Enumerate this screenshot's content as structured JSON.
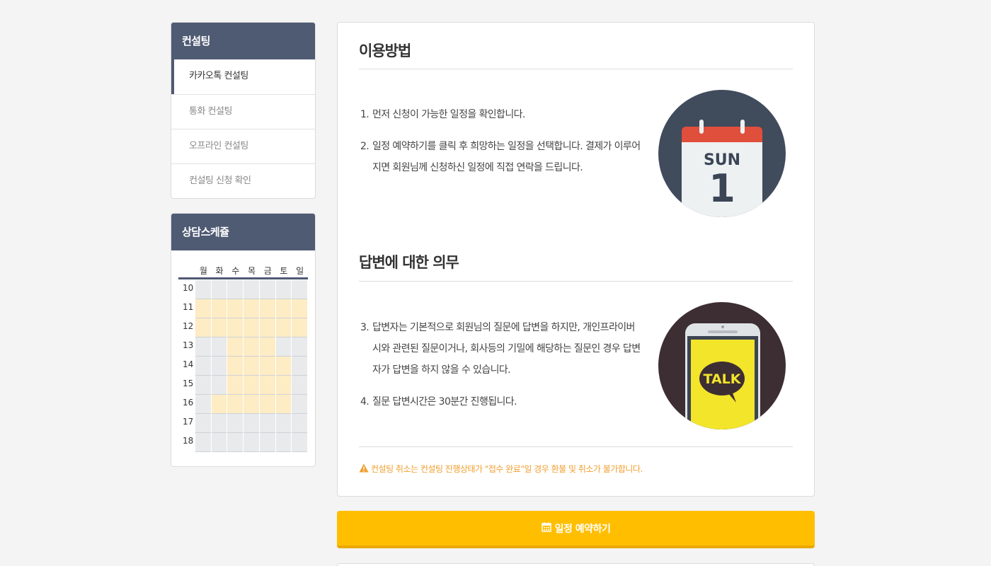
{
  "sidebar": {
    "consulting_title": "컨설팅",
    "menu": [
      {
        "label": "카카오톡 컨설팅",
        "active": true
      },
      {
        "label": "통화 컨설팅",
        "active": false
      },
      {
        "label": "오프라인 컨설팅",
        "active": false
      },
      {
        "label": "컨설팅 신청 확인",
        "active": false
      }
    ],
    "schedule_title": "상담스케쥴",
    "schedule": {
      "days": [
        "월",
        "화",
        "수",
        "목",
        "금",
        "토",
        "일"
      ],
      "hours": [
        "10",
        "11",
        "12",
        "13",
        "14",
        "15",
        "16",
        "17",
        "18"
      ],
      "availability": [
        [
          0,
          0,
          0,
          0,
          0,
          0,
          0
        ],
        [
          1,
          1,
          1,
          1,
          1,
          1,
          1
        ],
        [
          1,
          1,
          1,
          1,
          1,
          1,
          1
        ],
        [
          0,
          0,
          1,
          1,
          1,
          0,
          0
        ],
        [
          0,
          0,
          1,
          1,
          1,
          1,
          0
        ],
        [
          0,
          0,
          1,
          1,
          1,
          1,
          0
        ],
        [
          0,
          1,
          1,
          1,
          1,
          1,
          0
        ],
        [
          0,
          0,
          0,
          0,
          0,
          0,
          0
        ],
        [
          0,
          0,
          0,
          0,
          0,
          0,
          0
        ]
      ]
    }
  },
  "main": {
    "section1": {
      "title": "이용방법",
      "steps": [
        {
          "num": "1.",
          "text": "먼저 신청이 가능한 일정을 확인합니다."
        },
        {
          "num": "2.",
          "text": "일정 예약하기를 클릭 후 희망하는 일정을 선택합니다. 결제가 이루어지면 회원님께 신청하신 일정에 직접 연락을 드립니다."
        }
      ],
      "calendar_day": "SUN",
      "calendar_date": "1"
    },
    "section2": {
      "title": "답변에 대한 의무",
      "steps": [
        {
          "num": "3.",
          "text": "답변자는 기본적으로 회원님의 질문에 답변을 하지만, 개인프라이버시와 관련된 질문이거나, 회사등의 기밀에 해당하는 질문인 경우 답변자가 답변을 하지 않을 수 있습니다."
        },
        {
          "num": "4.",
          "text": "질문 답변시간은 30분간 진행됩니다."
        }
      ],
      "phone_text": "TALK"
    },
    "warning": "컨설팅 취소는 컨설팅 진행상태가 \"접수 완료\"일 경우 환불 및 취소가 불가합니다."
  },
  "reserve_button": {
    "label": "일정 예약하기",
    "icon": "calendar-icon"
  },
  "colors": {
    "sidebar_header": "#4f5a73",
    "button": "#ffbf00",
    "warning": "#f0a030",
    "available": "#fdecc4"
  }
}
